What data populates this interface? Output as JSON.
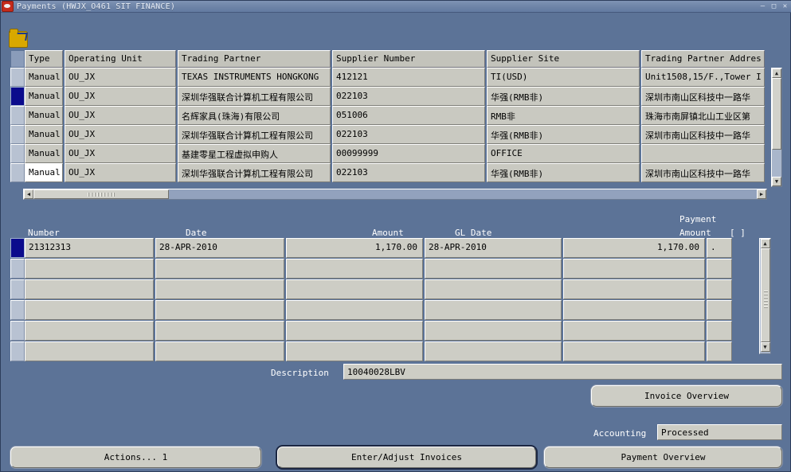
{
  "window": {
    "title": "Payments (HWJX_O461 SIT FINANCE)",
    "app_icon": "oracle-icon",
    "minimize": "–",
    "maximize": "□",
    "close": "✕"
  },
  "toolbar": {
    "folder_icon": "folder-open-icon"
  },
  "master": {
    "columns": [
      "Type",
      "Operating Unit",
      "Trading Partner",
      "Supplier Number",
      "Supplier Site",
      "Trading Partner Addres"
    ],
    "rows": [
      {
        "selected": false,
        "focus": false,
        "type": "Manual",
        "ou": "OU_JX",
        "partner": "TEXAS INSTRUMENTS HONGKONG",
        "supplier_number": "412121",
        "supplier_site": "TI(USD)",
        "address": "Unit1508,15/F.,Tower I"
      },
      {
        "selected": true,
        "focus": false,
        "type": "Manual",
        "ou": "OU_JX",
        "partner": "深圳华强联合计算机工程有限公司",
        "supplier_number": "022103",
        "supplier_site": "华强(RMB非)",
        "address": "深圳市南山区科技中一路华"
      },
      {
        "selected": false,
        "focus": false,
        "type": "Manual",
        "ou": "OU_JX",
        "partner": "名辉家具(珠海)有限公司",
        "supplier_number": "051006",
        "supplier_site": "RMB非",
        "address": "珠海市南屏镇北山工业区第"
      },
      {
        "selected": false,
        "focus": false,
        "type": "Manual",
        "ou": "OU_JX",
        "partner": "深圳华强联合计算机工程有限公司",
        "supplier_number": "022103",
        "supplier_site": "华强(RMB非)",
        "address": "深圳市南山区科技中一路华"
      },
      {
        "selected": false,
        "focus": false,
        "type": "Manual",
        "ou": "OU_JX",
        "partner": "基建零星工程虚拟申购人",
        "supplier_number": "00099999",
        "supplier_site": "OFFICE",
        "address": ""
      },
      {
        "selected": false,
        "focus": true,
        "type": "Manual",
        "ou": "OU_JX",
        "partner": "深圳华强联合计算机工程有限公司",
        "supplier_number": "022103",
        "supplier_site": "华强(RMB非)",
        "address": "深圳市南山区科技中一路华"
      }
    ],
    "scroll_up_icon": "▲",
    "scroll_down_icon": "▼",
    "scroll_left_icon": "◀",
    "scroll_right_icon": "▶"
  },
  "detail": {
    "columns": {
      "number": "Number",
      "date": "Date",
      "amount": "Amount",
      "gl_date": "GL Date",
      "payment_line1": "Payment",
      "payment_line2": "Amount",
      "flag": "[   ]"
    },
    "rows": [
      {
        "selected": true,
        "number": "21312313",
        "date": "28-APR-2010",
        "amount": "1,170.00",
        "gl_date": "28-APR-2010",
        "payment_amount": "1,170.00",
        "flag": "."
      },
      {
        "selected": false,
        "number": "",
        "date": "",
        "amount": "",
        "gl_date": "",
        "payment_amount": "",
        "flag": ""
      },
      {
        "selected": false,
        "number": "",
        "date": "",
        "amount": "",
        "gl_date": "",
        "payment_amount": "",
        "flag": ""
      },
      {
        "selected": false,
        "number": "",
        "date": "",
        "amount": "",
        "gl_date": "",
        "payment_amount": "",
        "flag": ""
      },
      {
        "selected": false,
        "number": "",
        "date": "",
        "amount": "",
        "gl_date": "",
        "payment_amount": "",
        "flag": ""
      },
      {
        "selected": false,
        "number": "",
        "date": "",
        "amount": "",
        "gl_date": "",
        "payment_amount": "",
        "flag": ""
      }
    ]
  },
  "form": {
    "description_label": "Description",
    "description_value": "10040028LBV",
    "invoice_overview_button": "Invoice Overview",
    "invoice_overview_accel": "n",
    "accounting_label": "Accounting",
    "accounting_value": "Processed"
  },
  "buttons": {
    "actions": "Actions... 1",
    "actions_accel": "A",
    "enter_adjust": "Enter/Adjust Invoices",
    "enter_adjust_accel": "I",
    "payment_overview": "Payment Overview",
    "payment_overview_accel": "O"
  },
  "colors": {
    "background": "#5c7397",
    "field": "#cdcdc5",
    "header": "#c3c3bb",
    "selected_row": "#0b0b8c",
    "title_text": "#e6ecf5"
  }
}
